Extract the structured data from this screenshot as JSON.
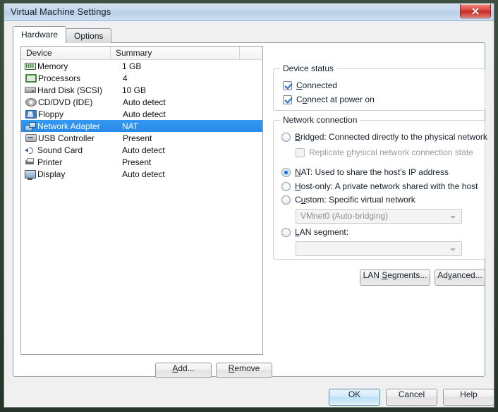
{
  "window": {
    "title": "Virtual Machine Settings",
    "close_label": "close-icon"
  },
  "tabs": [
    {
      "label": "Hardware",
      "active": true
    },
    {
      "label": "Options",
      "active": false
    }
  ],
  "device_list": {
    "columns": [
      "Device",
      "Summary",
      ""
    ],
    "rows": [
      {
        "name": "Memory",
        "summary": "1 GB",
        "icon": "memory-icon",
        "selected": false
      },
      {
        "name": "Processors",
        "summary": "4",
        "icon": "processor-icon",
        "selected": false
      },
      {
        "name": "Hard Disk (SCSI)",
        "summary": "10 GB",
        "icon": "harddisk-icon",
        "selected": false
      },
      {
        "name": "CD/DVD (IDE)",
        "summary": "Auto detect",
        "icon": "cddvd-icon",
        "selected": false
      },
      {
        "name": "Floppy",
        "summary": "Auto detect",
        "icon": "floppy-icon",
        "selected": false
      },
      {
        "name": "Network Adapter",
        "summary": "NAT",
        "icon": "network-adapter-icon",
        "selected": true
      },
      {
        "name": "USB Controller",
        "summary": "Present",
        "icon": "usb-icon",
        "selected": false
      },
      {
        "name": "Sound Card",
        "summary": "Auto detect",
        "icon": "soundcard-icon",
        "selected": false
      },
      {
        "name": "Printer",
        "summary": "Present",
        "icon": "printer-icon",
        "selected": false
      },
      {
        "name": "Display",
        "summary": "Auto detect",
        "icon": "display-icon",
        "selected": false
      }
    ],
    "add_label": "Add...",
    "remove_label": "Remove"
  },
  "device_status": {
    "title": "Device status",
    "connected": {
      "label": "Connected",
      "checked": true
    },
    "connect_at_power_on": {
      "label": "Connect at power on",
      "checked": true
    }
  },
  "network_connection": {
    "title": "Network connection",
    "bridged": {
      "label": "Bridged: Connected directly to the physical network",
      "selected": false
    },
    "replicate": {
      "label": "Replicate physical network connection state",
      "checked": false,
      "disabled": true
    },
    "nat": {
      "label": "NAT: Used to share the host's IP address",
      "selected": true
    },
    "host_only": {
      "label": "Host-only: A private network shared with the host",
      "selected": false
    },
    "custom": {
      "label": "Custom: Specific virtual network",
      "selected": false
    },
    "custom_combo": {
      "value": "VMnet0 (Auto-bridging)",
      "disabled": true
    },
    "lan_segment": {
      "label": "LAN segment:",
      "selected": false
    },
    "lan_combo": {
      "value": "",
      "disabled": true
    },
    "lan_segments_button": "LAN Segments...",
    "advanced_button": "Advanced..."
  },
  "footer": {
    "ok": "OK",
    "cancel": "Cancel",
    "help": "Help"
  },
  "colors": {
    "selection_blue": "#3399f2",
    "accent_blue": "#1f76d2",
    "close_red": "#c62d26"
  }
}
